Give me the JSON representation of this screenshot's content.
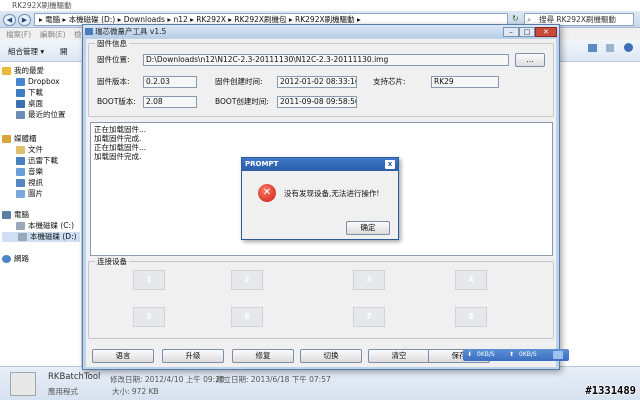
{
  "explorer": {
    "title": "RK292X刷機驅動",
    "path": "▸ 電腦 ▸ 本機磁碟 (D:) ▸ Downloads ▸ n12 ▸ RK292X ▸ RK292X刷機包 ▸ RK292X刷機驅動 ▸",
    "search_placeholder": "搜尋 RK292X刷機驅動",
    "menu": [
      "檔案(F)",
      "編輯(E)",
      "檢"
    ],
    "toolbar": [
      "組合管理 ▾",
      "開"
    ],
    "nav": {
      "favorites": "我的最愛",
      "fav_items": [
        "Dropbox",
        "下載",
        "桌面",
        "最近的位置"
      ],
      "libraries": "媒體櫃",
      "lib_items": [
        "文件",
        "迅雷下載",
        "音樂",
        "視訊",
        "圖片"
      ],
      "computer": "電腦",
      "drives": [
        "本機磁碟 (C:)",
        "本機磁碟 (D:)"
      ],
      "network": "網路"
    },
    "status": {
      "filename": "RKBatchTool",
      "modified": "修改日期: 2012/4/10 上午 09:20",
      "created": "建立日期: 2013/6/18 下午 07:57",
      "type": "應用程式",
      "size": "大小: 972 KB"
    }
  },
  "tool": {
    "title": "瑞芯微量产工具 v1.5",
    "firmware_group": "固件信息",
    "path_label": "固件位置:",
    "path_value": "D:\\Downloads\\n12\\N12C-2.3-20111130\\N12C-2.3-20111130.img",
    "browse_label": "...",
    "version_label": "固件版本:",
    "version_value": "0.2.03",
    "created_label": "固件创建时间:",
    "created_value": "2012-01-02 08:33:16",
    "chip_label": "支持芯片:",
    "chip_value": "RK29",
    "boot_version_label": "BOOT版本:",
    "boot_version_value": "2.08",
    "boot_created_label": "BOOT创建时间:",
    "boot_created_value": "2011-09-08 09:58:56",
    "log": [
      "正在加载固件...",
      "加载固件完成.",
      "正在加载固件...",
      "加载固件完成."
    ],
    "device_group": "连接设备",
    "devices": [
      "1",
      "2",
      "3",
      "4",
      "5",
      "6",
      "7",
      "8"
    ],
    "buttons": [
      "语言",
      "升级",
      "修复",
      "切换",
      "清空",
      "保存"
    ]
  },
  "prompt": {
    "title": "PROMPT",
    "message": "没有发现设备,无法进行操作!",
    "ok_label": "确定",
    "close": "x"
  },
  "transfer": {
    "down": "0KB/S",
    "up": "0KB/S"
  },
  "watermark": "#1331489"
}
